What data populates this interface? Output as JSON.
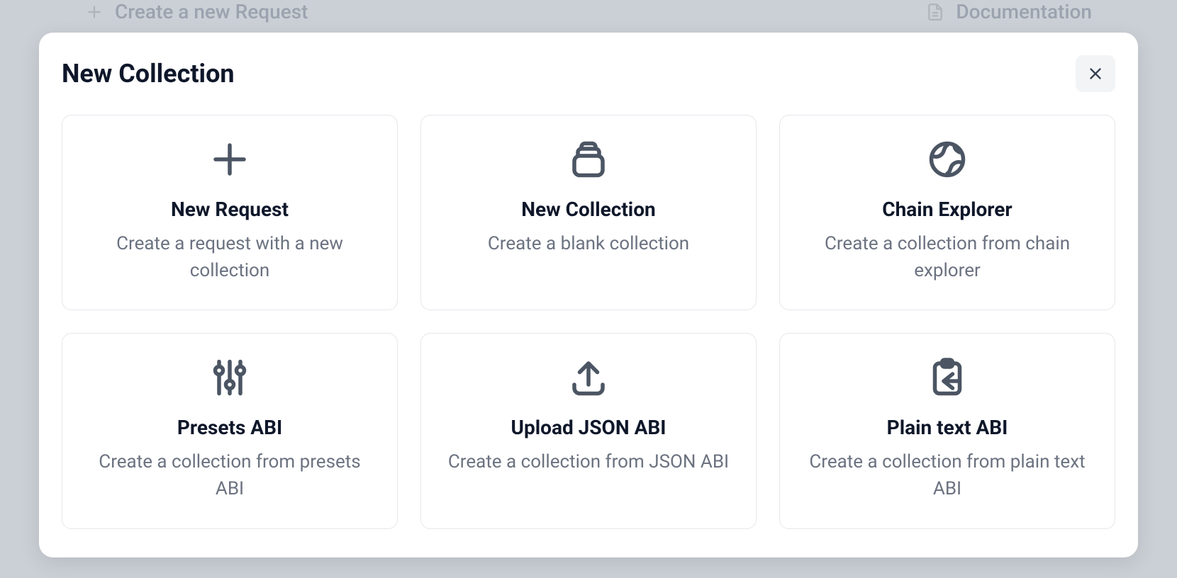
{
  "background": {
    "create_request_label": "Create a new Request",
    "documentation_label": "Documentation"
  },
  "modal": {
    "title": "New Collection",
    "cards": [
      {
        "title": "New Request",
        "desc": "Create a request with a new collection"
      },
      {
        "title": "New Collection",
        "desc": "Create a blank collection"
      },
      {
        "title": "Chain Explorer",
        "desc": "Create a collection from chain explorer"
      },
      {
        "title": "Presets ABI",
        "desc": "Create a collection from presets ABI"
      },
      {
        "title": "Upload JSON ABI",
        "desc": "Create a collection from JSON ABI"
      },
      {
        "title": "Plain text ABI",
        "desc": "Create a collection from plain text ABI"
      }
    ]
  }
}
